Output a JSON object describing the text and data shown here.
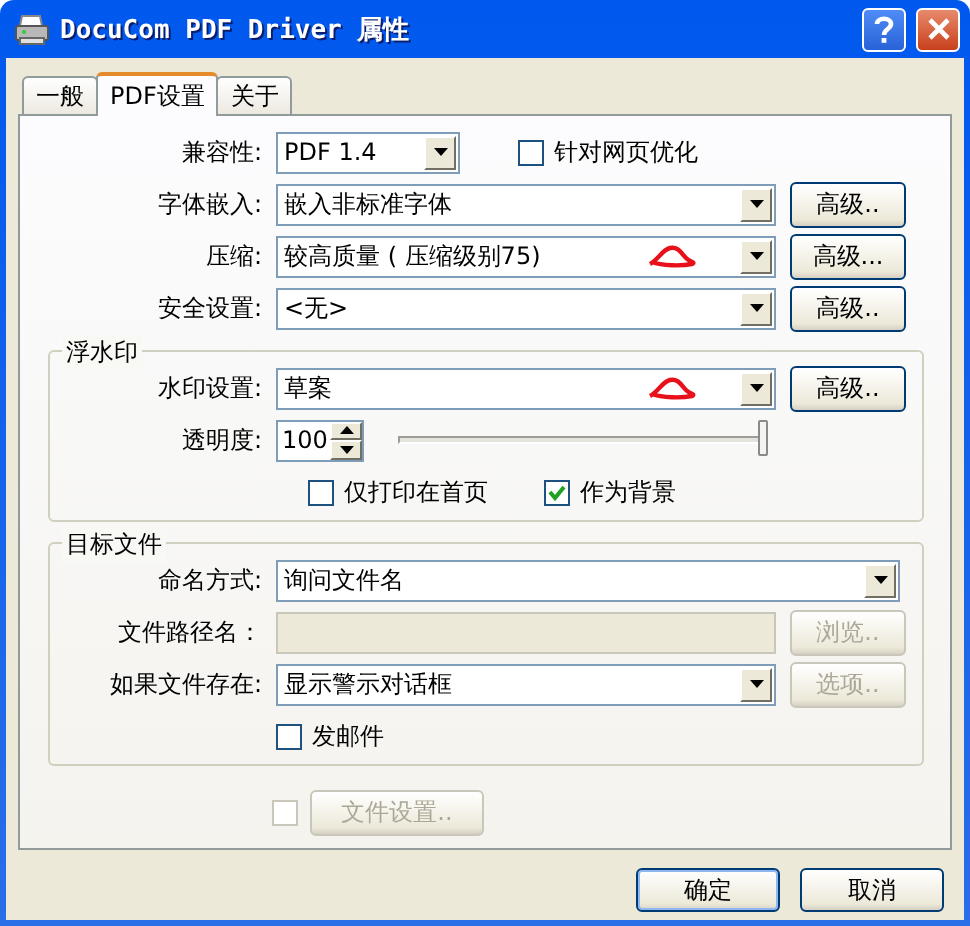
{
  "window": {
    "title": "DocuCom PDF Driver 属性"
  },
  "tabs": [
    {
      "label": "一般",
      "selected": false
    },
    {
      "label": "PDF设置",
      "selected": true
    },
    {
      "label": "关于",
      "selected": false
    }
  ],
  "rows": [
    {
      "kind": "combo",
      "label": "兼容性:",
      "value": "PDF 1.4",
      "checkbox": {
        "label": "针对网页优化",
        "checked": false
      }
    },
    {
      "kind": "combo",
      "label": "字体嵌入:",
      "value": "嵌入非标准字体",
      "button": {
        "label": "高级..",
        "disabled": false
      }
    },
    {
      "kind": "combo",
      "label": "压缩:",
      "value": "较高质量 ( 压缩级别75)",
      "annotated": true,
      "button": {
        "label": "高级...",
        "disabled": false
      }
    },
    {
      "kind": "combo",
      "label": "安全设置:",
      "value": "<无>",
      "button": {
        "label": "高级..",
        "disabled": false
      }
    }
  ],
  "groups": [
    {
      "title": "浮水印",
      "rows": [
        {
          "kind": "combo",
          "label": "水印设置:",
          "value": "草案",
          "annotated": true,
          "button": {
            "label": "高级..",
            "disabled": false
          }
        },
        {
          "kind": "spinner",
          "label": "透明度:",
          "value": "100",
          "level": 1
        },
        {
          "kind": "checks",
          "items": [
            {
              "label": "仅打印在首页",
              "checked": false
            },
            {
              "label": "作为背景",
              "checked": true
            }
          ]
        }
      ]
    },
    {
      "title": "目标文件",
      "rows": [
        {
          "kind": "combo",
          "label": "命名方式:",
          "value": "询问文件名"
        },
        {
          "kind": "text",
          "label": "文件路径名：",
          "disabled": true,
          "button": {
            "label": "浏览..",
            "disabled": true
          }
        },
        {
          "kind": "combo",
          "label": "如果文件存在:",
          "value": "显示警示对话框",
          "button": {
            "label": "选项..",
            "disabled": true
          }
        },
        {
          "kind": "checks",
          "items": [
            {
              "label": "发邮件",
              "checked": false
            }
          ]
        }
      ]
    }
  ],
  "file_settings": {
    "checked": false,
    "button": {
      "label": "文件设置..",
      "disabled": true
    }
  },
  "buttons": [
    {
      "label": "确定",
      "default": true
    },
    {
      "label": "取消",
      "default": false
    }
  ]
}
